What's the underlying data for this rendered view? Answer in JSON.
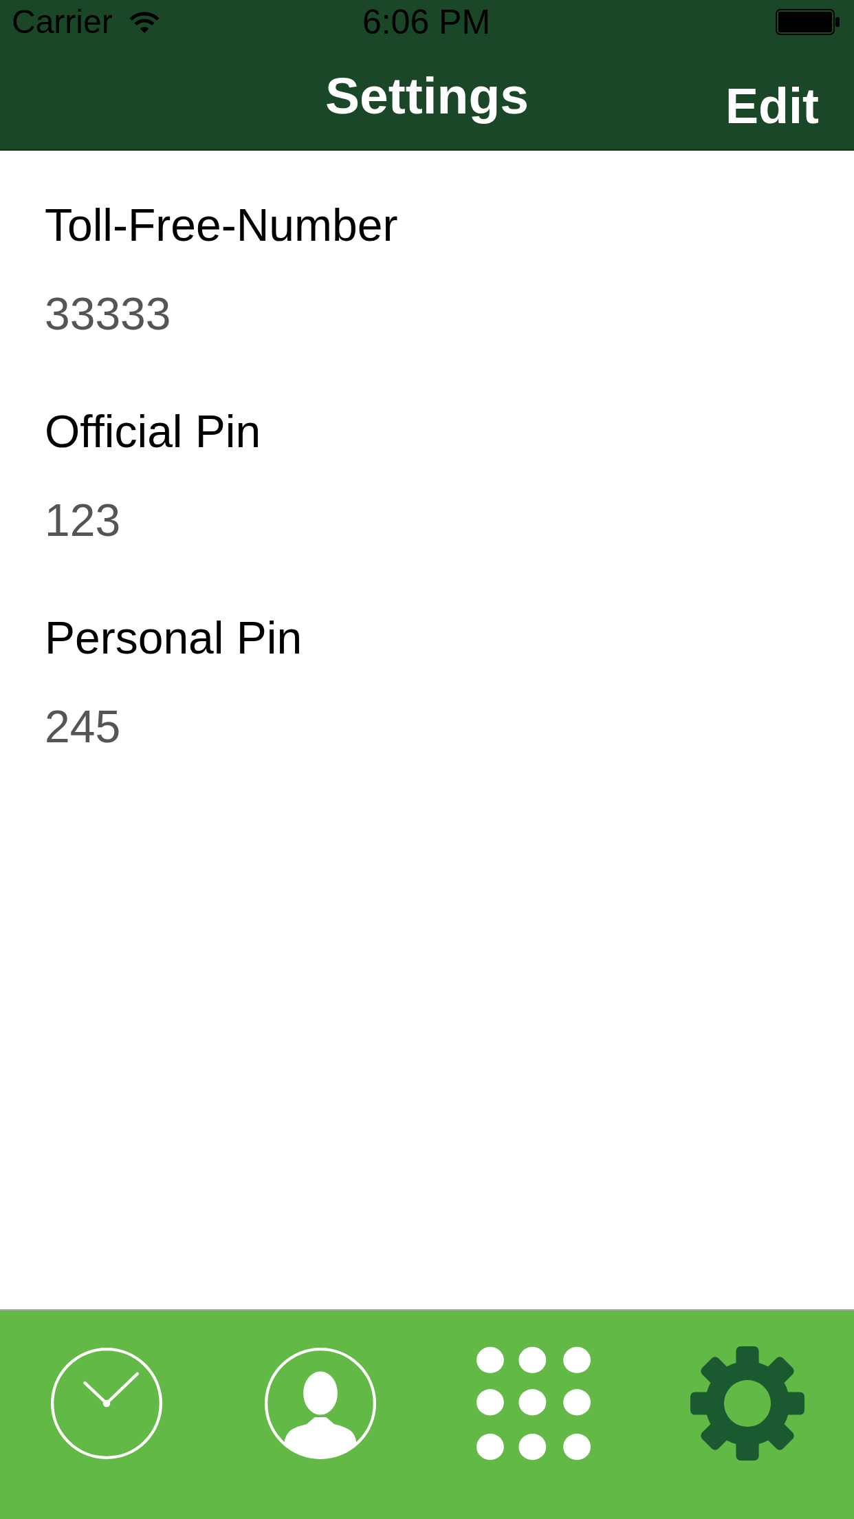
{
  "status_bar": {
    "carrier": "Carrier",
    "time": "6:06 PM"
  },
  "nav_bar": {
    "title": "Settings",
    "edit_button": "Edit"
  },
  "settings": [
    {
      "label": "Toll-Free-Number",
      "value": "33333"
    },
    {
      "label": "Official Pin",
      "value": "123"
    },
    {
      "label": "Personal Pin",
      "value": "245"
    }
  ],
  "tab_bar": {
    "tabs": [
      {
        "kind": "clock",
        "selected": false
      },
      {
        "kind": "person",
        "selected": false
      },
      {
        "kind": "dots",
        "selected": false
      },
      {
        "kind": "gear",
        "selected": true
      }
    ]
  }
}
